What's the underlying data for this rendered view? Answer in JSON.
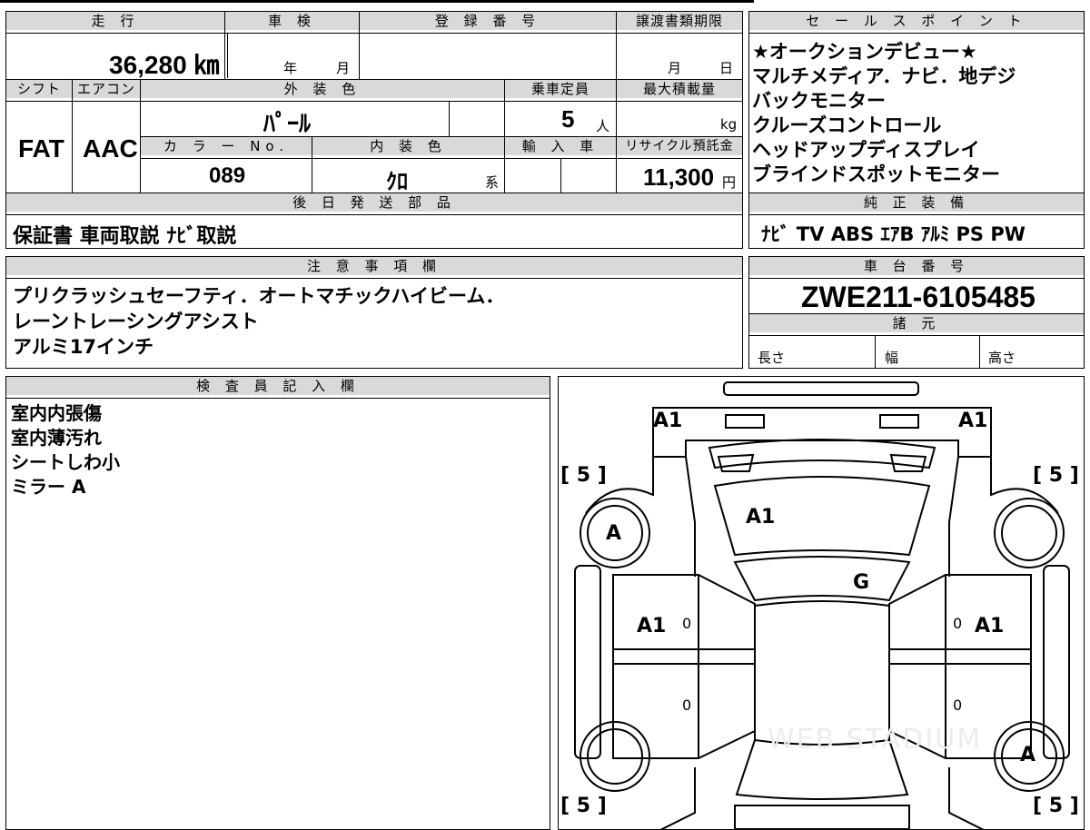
{
  "top": {
    "mileage_label": "走 行",
    "inspection_label": "車 検",
    "registration_label": "登 録 番 号",
    "transfer_deadline_label": "譲渡書類期限",
    "mileage_value": "36,280 ㎞",
    "year_unit": "年",
    "month_unit": "月",
    "deadline_month": "月",
    "deadline_day": "日"
  },
  "specs": {
    "shift_label": "シフト",
    "ac_label": "エアコン",
    "exterior_label": "外 装 色",
    "capacity_label": "乗車定員",
    "max_load_label": "最大積載量",
    "shift_value": "FAT",
    "ac_value": "AAC",
    "exterior_value": "ﾊﾟｰﾙ",
    "capacity_value": "5",
    "capacity_unit": "人",
    "load_unit": "kg",
    "color_no_label": "カ ラ ー No.",
    "interior_label": "内 装 色",
    "import_label": "輸 入 車",
    "recycle_label": "リサイクル預託金",
    "color_no_value": "089",
    "interior_value": "ｸﾛ",
    "interior_unit": "系",
    "recycle_value": "11,300",
    "recycle_unit": "円"
  },
  "later_parts": {
    "label": "後 日 発 送 部 品",
    "value": "保証書 車両取説 ﾅﾋﾞ取説"
  },
  "sales_points": {
    "label": "セ ー ル ス ポ イ ン ト",
    "lines": [
      "★オークションデビュー★",
      "マルチメディア．ナビ．地デジ",
      "バックモニター",
      "クルーズコントロール",
      "ヘッドアップディスプレイ",
      "ブラインドスポットモニター"
    ]
  },
  "equipment": {
    "label": "純 正 装 備",
    "value": "ﾅﾋﾞ  TV  ABS  ｴｱB  ｱﾙﾐ  PS  PW"
  },
  "notes": {
    "label": "注 意 事 項 欄",
    "lines": [
      "プリクラッシュセーフティ．オートマチックハイビーム．",
      "レーントレーシングアシスト",
      "アルミ17インチ"
    ]
  },
  "chassis": {
    "label": "車 台 番 号",
    "value": "ZWE211-6105485",
    "dims_label": "諸 元",
    "length_label": "長さ",
    "width_label": "幅",
    "height_label": "高さ"
  },
  "inspector": {
    "label": "検 査 員 記 入 欄",
    "lines": [
      "室内内張傷",
      "室内薄汚れ",
      "シートしわ小",
      "ミラー A"
    ]
  },
  "diagram": {
    "marks": {
      "front_left": "A1",
      "front_right": "A1",
      "hood": "A1",
      "windshield": "G",
      "left_front_door": "A1",
      "right_front_door": "A1",
      "left_front_wheel": "A",
      "right_rear_wheel": "A",
      "tire_fl": "5",
      "tire_fr": "5",
      "tire_rl": "5",
      "tire_rr": "5",
      "zero1": "0",
      "zero2": "0",
      "zero3": "0",
      "zero4": "0"
    },
    "watermark": "WEB STADIUM"
  }
}
